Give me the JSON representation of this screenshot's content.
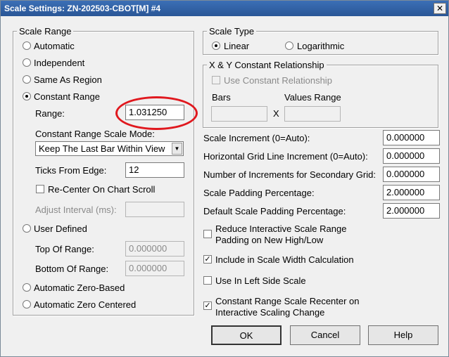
{
  "window": {
    "title": "Scale Settings: ZN-202503-CBOT[M] #4",
    "close_glyph": "✕"
  },
  "scale_range": {
    "legend": "Scale Range",
    "options": [
      "Automatic",
      "Independent",
      "Same As Region",
      "Constant Range"
    ],
    "selected": "Constant Range",
    "range_label": "Range:",
    "range_value": "1.031250",
    "mode_label": "Constant Range Scale Mode:",
    "mode_value": "Keep The Last Bar Within View",
    "ticks_label": "Ticks From Edge:",
    "ticks_value": "12",
    "recenter_label": "Re-Center On Chart Scroll",
    "recenter_checked": false,
    "adjust_label": "Adjust Interval (ms):",
    "adjust_value": "",
    "user_defined_label": "User Defined",
    "top_label": "Top Of Range:",
    "top_value": "0.000000",
    "bottom_label": "Bottom Of Range:",
    "bottom_value": "0.000000",
    "zero_based_label": "Automatic Zero-Based",
    "zero_centered_label": "Automatic Zero Centered"
  },
  "scale_type": {
    "legend": "Scale Type",
    "linear_label": "Linear",
    "log_label": "Logarithmic",
    "selected": "Linear"
  },
  "xy": {
    "legend": "X & Y Constant Relationship",
    "use_label": "Use Constant Relationship",
    "bars_label": "Bars",
    "values_label": "Values Range",
    "x_label": "X",
    "bars_value": "",
    "values_value": ""
  },
  "settings": {
    "scale_increment_label": "Scale Increment (0=Auto):",
    "scale_increment_value": "0.000000",
    "hgrid_label": "Horizontal Grid Line Increment (0=Auto):",
    "hgrid_value": "0.000000",
    "secondary_grid_label": "Number of Increments for Secondary Grid:",
    "secondary_grid_value": "0.000000",
    "padding_label": "Scale Padding Percentage:",
    "padding_value": "2.000000",
    "default_padding_label": "Default Scale Padding Percentage:",
    "default_padding_value": "2.000000"
  },
  "checks": {
    "reduce_line1": "Reduce Interactive Scale Range",
    "reduce_line2": "Padding on New High/Low",
    "reduce_checked": false,
    "include_label": "Include in Scale Width Calculation",
    "include_checked": true,
    "left_side_label": "Use In Left Side Scale",
    "left_side_checked": false,
    "recenter_line1": "Constant Range Scale Recenter on",
    "recenter_line2": "Interactive Scaling Change",
    "recenter_checked": true
  },
  "buttons": {
    "ok": "OK",
    "cancel": "Cancel",
    "help": "Help"
  },
  "glyphs": {
    "check": "✓",
    "dropdown": "▼"
  },
  "colors": {
    "highlight": "#e0181e",
    "titlebar": "#2a5696"
  }
}
